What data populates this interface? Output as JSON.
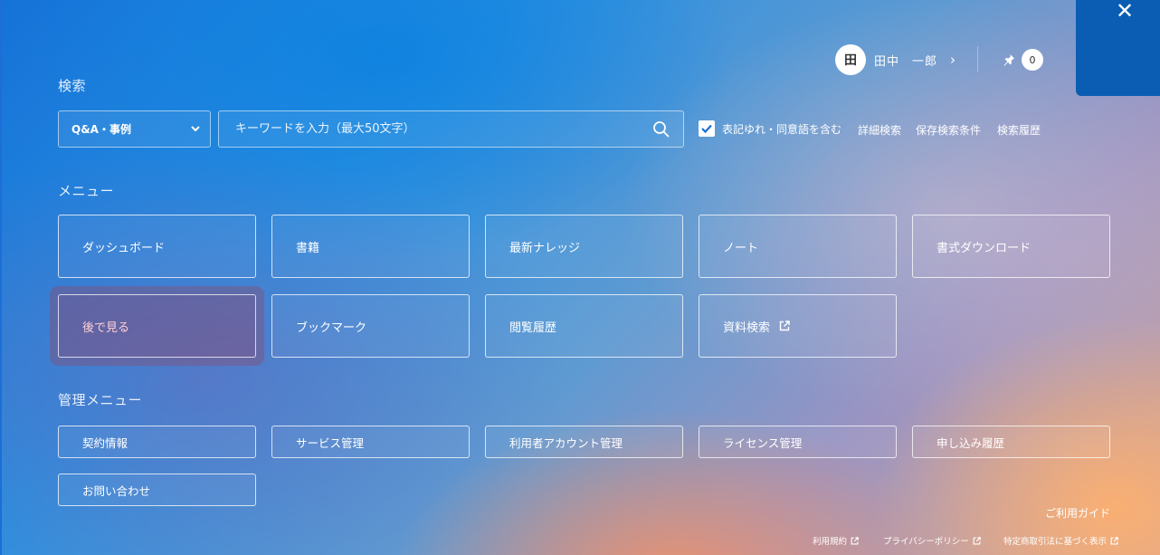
{
  "header": {
    "close_icon": "close-icon",
    "user": {
      "avatar_initial": "田",
      "name": "田中　一郎",
      "chevron": "›"
    },
    "notifications": {
      "icon": "pin-icon",
      "count": "0"
    }
  },
  "search": {
    "section_label": "検索",
    "category": "Q&A・事例",
    "placeholder": "キーワードを入力（最大50文字）",
    "checkbox_label": "表記ゆれ・同意語を含む",
    "checkbox_checked": true,
    "links": [
      "詳細検索",
      "保存検索条件",
      "検索履歴"
    ]
  },
  "menu": {
    "section_label": "メニュー",
    "items": [
      {
        "label": "ダッシュボード"
      },
      {
        "label": "書籍"
      },
      {
        "label": "最新ナレッジ"
      },
      {
        "label": "ノート"
      },
      {
        "label": "書式ダウンロード"
      },
      {
        "label": "後で見る"
      },
      {
        "label": "ブックマーク"
      },
      {
        "label": "閲覧履歴"
      },
      {
        "label": "資料検索"
      }
    ]
  },
  "admin_menu": {
    "section_label": "管理メニュー",
    "items": [
      {
        "label": "契約情報"
      },
      {
        "label": "サービス管理"
      },
      {
        "label": "利用者アカウント管理"
      },
      {
        "label": "ライセンス管理"
      },
      {
        "label": "申し込み履歴"
      },
      {
        "label": "お問い合わせ"
      }
    ]
  },
  "footer": {
    "guide": "ご利用ガイド",
    "links": [
      "利用規約",
      "プライバシーポリシー",
      "特定商取引法に基づく表示"
    ]
  },
  "colors": {
    "close_panel": "#0a5db3",
    "highlight": "#8c466e",
    "checkbox_check": "#1b6fd6"
  }
}
